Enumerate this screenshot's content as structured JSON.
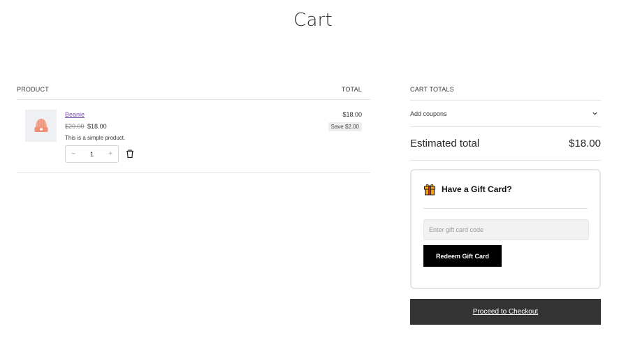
{
  "page": {
    "title": "Cart"
  },
  "cart_table": {
    "col_product": "Product",
    "col_total": "Total",
    "items": [
      {
        "name": "Beanie",
        "regular_price": "$20.00",
        "sale_price": "$18.00",
        "description": "This is a simple product.",
        "quantity": "1",
        "qty_minus": "−",
        "qty_plus": "+",
        "line_total": "$18.00",
        "savings": "Save $2.00",
        "thumb_icon": "beanie-hat-icon",
        "remove_icon": "trash-icon"
      }
    ]
  },
  "sidebar": {
    "heading": "Cart Totals",
    "coupons_label": "Add coupons",
    "coupons_icon": "chevron-down-icon",
    "estimated_label": "Estimated total",
    "estimated_value": "$18.00",
    "gift_card": {
      "title": "Have a Gift Card?",
      "icon": "gift-icon",
      "placeholder": "Enter gift card code",
      "button_label": "Redeem Gift Card"
    },
    "checkout_label": "Proceed to Checkout"
  },
  "colors": {
    "link": "#7f54b3",
    "checkout_bg": "#333333",
    "redeem_bg": "#000000",
    "beanie": "#f0a088",
    "gift": "#f39c12"
  }
}
